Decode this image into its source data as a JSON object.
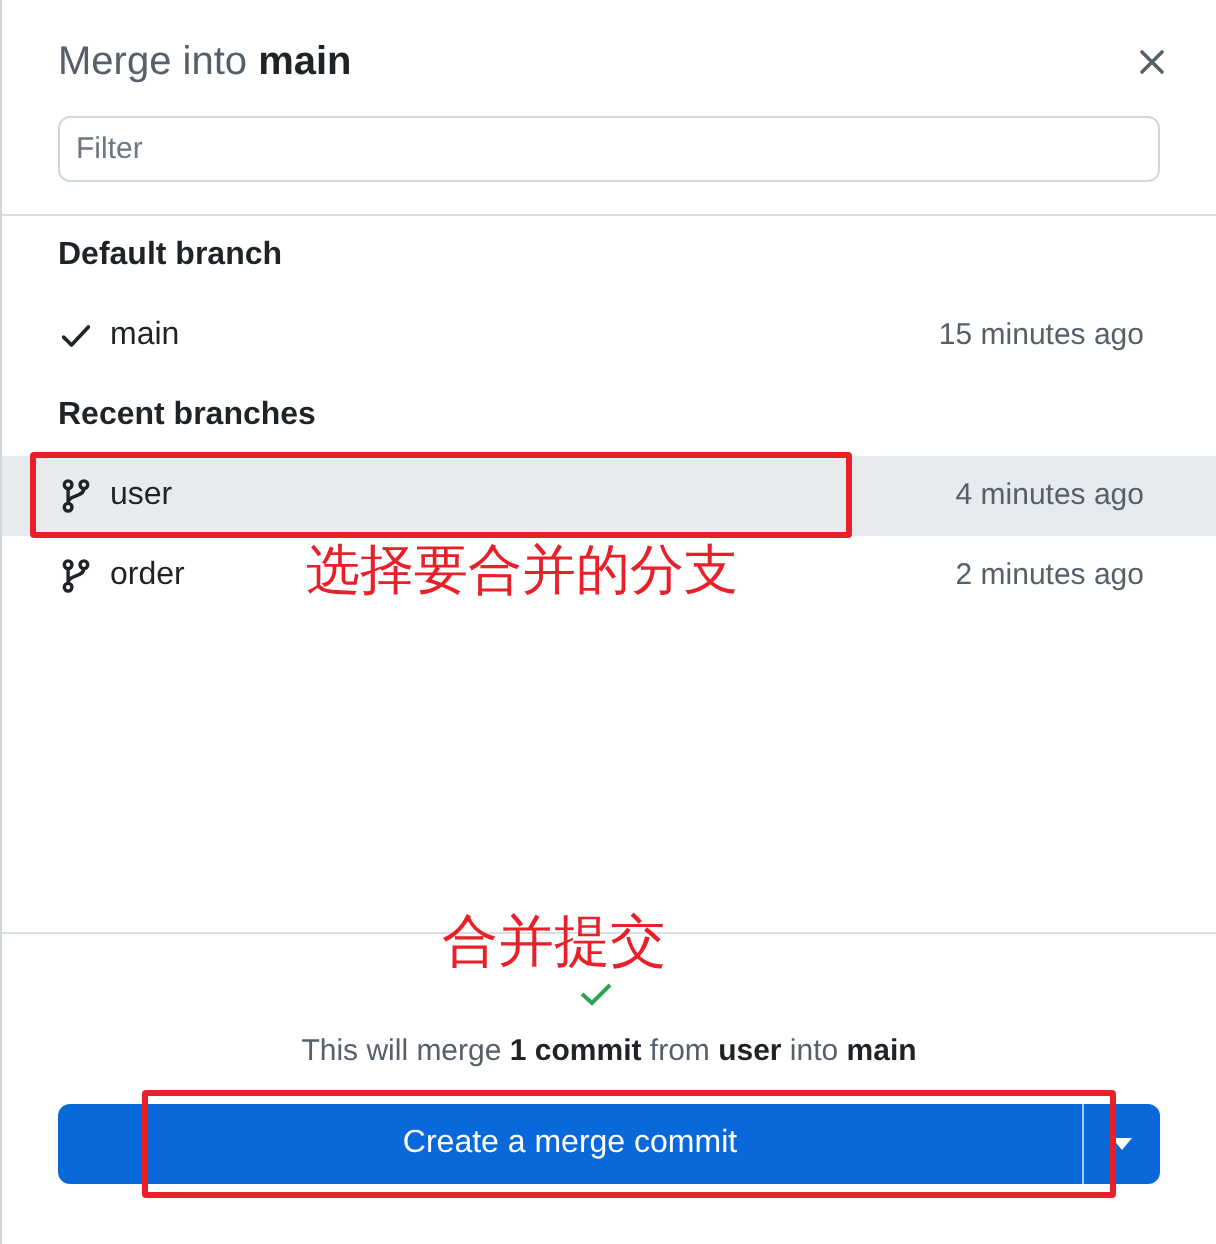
{
  "dialog": {
    "title": "Merge into **main**",
    "filter": {
      "placeholder": "Filter"
    }
  },
  "sections": [
    {
      "heading": "Default branch",
      "branches": [
        {
          "kind": "check",
          "name": "main",
          "time": "15 minutes ago",
          "selected": false
        }
      ]
    },
    {
      "heading": "Recent branches",
      "branches": [
        {
          "kind": "branch",
          "name": "user",
          "time": "4 minutes ago",
          "selected": true
        },
        {
          "kind": "branch",
          "name": "order",
          "time": "2 minutes ago",
          "selected": false
        }
      ]
    }
  ],
  "footer": {
    "summary": "This will merge **1 commit** from **user** into **main**",
    "button": "Create a merge commit"
  },
  "annotations": [
    {
      "kind": "box"
    },
    {
      "kind": "label",
      "text": "选择要合并的分支"
    },
    {
      "kind": "label",
      "text": "合并提交"
    },
    {
      "kind": "box"
    }
  ]
}
